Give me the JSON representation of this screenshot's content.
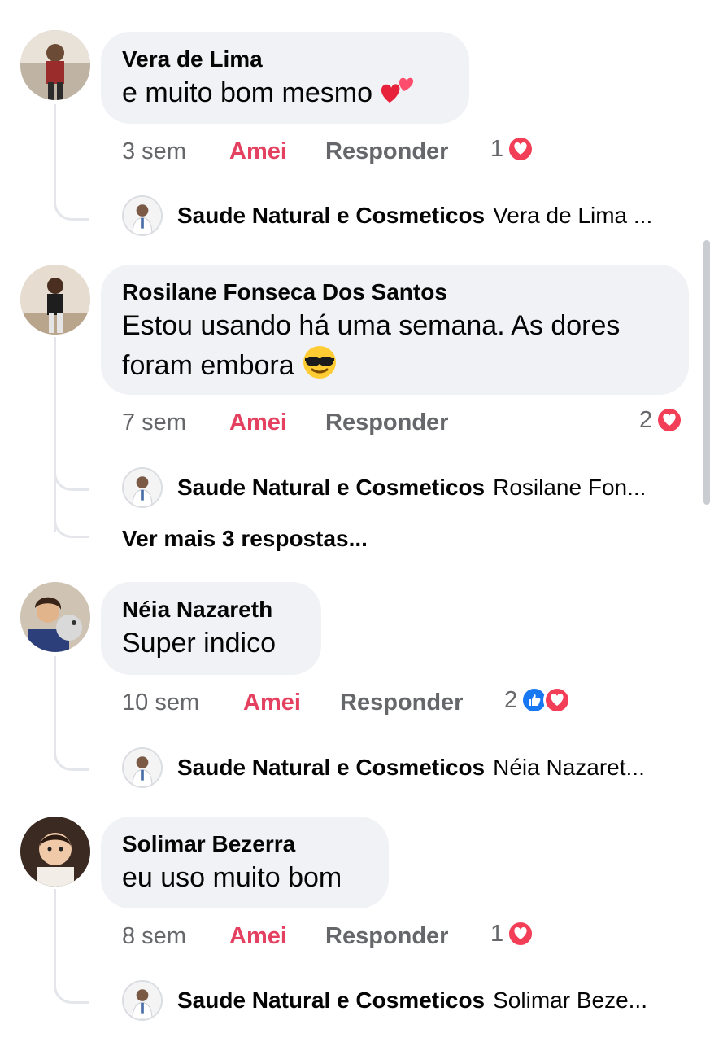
{
  "comments": [
    {
      "author": "Vera de Lima",
      "text": "e muito bom mesmo",
      "emoji": "two-hearts",
      "time": "3 sem",
      "love_label": "Amei",
      "reply_label": "Responder",
      "reaction_count": "1",
      "reactions": [
        "heart"
      ],
      "reply": {
        "name": "Saude Natural e Cosmeticos",
        "preview": "Vera de Lima ..."
      }
    },
    {
      "author": "Rosilane Fonseca Dos Santos",
      "text_line1": "Estou usando há uma semana. As dores",
      "text_line2": "foram embora",
      "emoji": "sunglasses-face",
      "time": "7 sem",
      "love_label": "Amei",
      "reply_label": "Responder",
      "reaction_count": "2",
      "reactions": [
        "heart"
      ],
      "reply": {
        "name": "Saude Natural e Cosmeticos",
        "preview": "Rosilane Fon..."
      },
      "more_replies": "Ver mais 3 respostas..."
    },
    {
      "author": "Néia Nazareth",
      "text": "Super indico",
      "time": "10 sem",
      "love_label": "Amei",
      "reply_label": "Responder",
      "reaction_count": "2",
      "reactions": [
        "like",
        "heart"
      ],
      "reply": {
        "name": "Saude Natural e Cosmeticos",
        "preview": "Néia Nazaret..."
      }
    },
    {
      "author": "Solimar Bezerra",
      "text": "eu uso muito bom",
      "time": "8 sem",
      "love_label": "Amei",
      "reply_label": "Responder",
      "reaction_count": "1",
      "reactions": [
        "heart"
      ],
      "reply": {
        "name": "Saude Natural e Cosmeticos",
        "preview": "Solimar Beze..."
      }
    }
  ],
  "colors": {
    "bubble": "#f0f2f5",
    "love": "#e4405f",
    "meta": "#65676b",
    "like_blue": "#1877f2",
    "heart_red": "#f33e58"
  }
}
